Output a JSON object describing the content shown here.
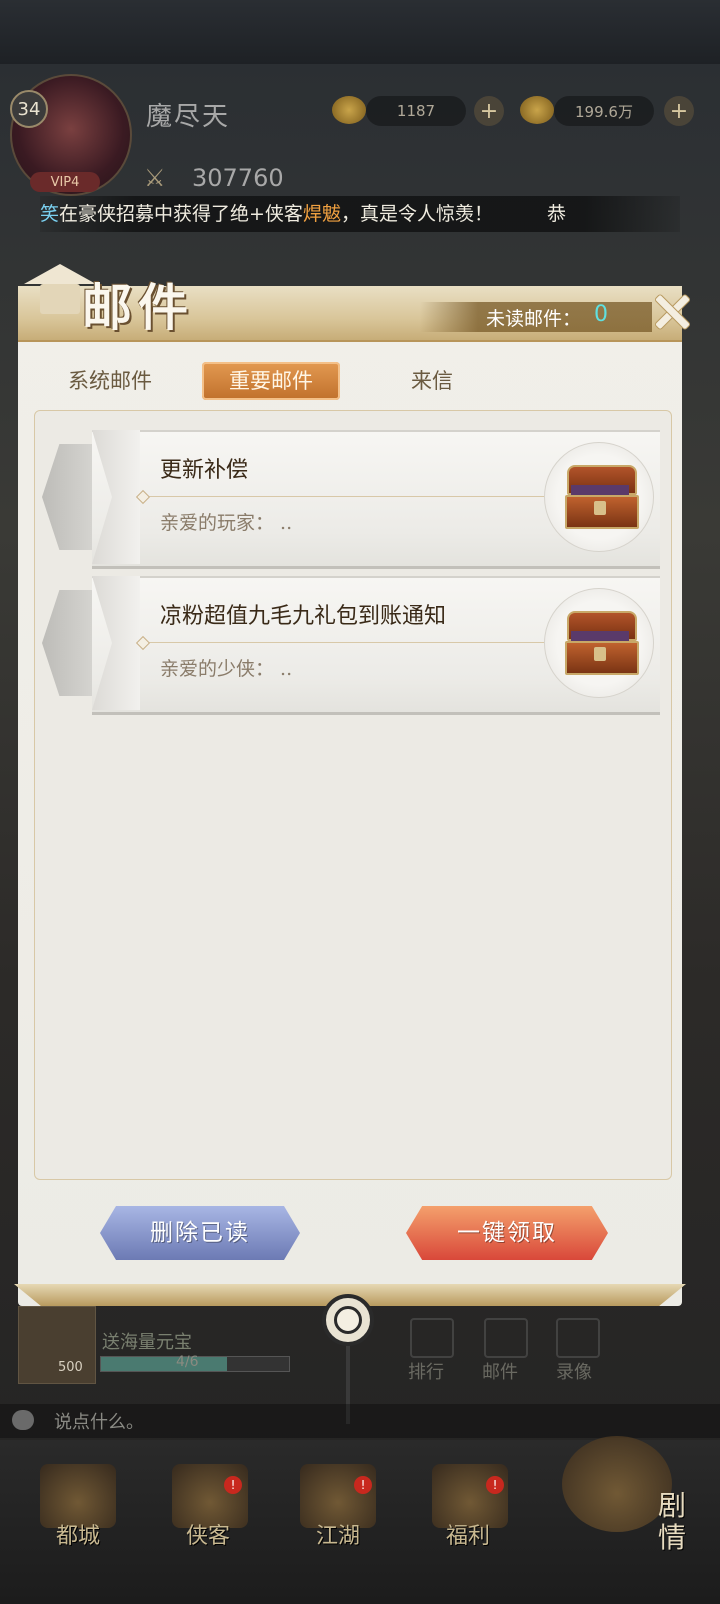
{
  "hud": {
    "level": "34",
    "vip": "VIP4",
    "player_name": "魔尽天",
    "gold": "1187",
    "coins": "199.6万",
    "power": "307760"
  },
  "marquee": {
    "part1": "笑",
    "part2": "在豪侠招募中获得了绝+侠客",
    "part3": "焊魃",
    "part4": "，真是令人惊羡！",
    "part5": "恭"
  },
  "mail_panel": {
    "title": "邮件",
    "unread_label": "未读邮件：",
    "unread_count": "0",
    "tabs": [
      {
        "label": "系统邮件",
        "active": false
      },
      {
        "label": "重要邮件",
        "active": true
      },
      {
        "label": "来信",
        "active": false
      }
    ],
    "mails": [
      {
        "title": "更新补偿",
        "preview": "亲爱的玩家：  ..",
        "icon": "treasure-chest-icon"
      },
      {
        "title": "凉粉超值九毛九礼包到账通知",
        "preview": "亲爱的少侠：  ..",
        "icon": "treasure-chest-icon"
      }
    ],
    "delete_read_label": "删除已读",
    "claim_all_label": "一键领取"
  },
  "event": {
    "count": "500",
    "text": "送海量元宝",
    "progress": "4/6",
    "progress_fraction": 0.67
  },
  "side_buttons": [
    "排行",
    "邮件",
    "录像"
  ],
  "chat_placeholder": "说点什么。",
  "nav": [
    {
      "label": "都城"
    },
    {
      "label": "侠客"
    },
    {
      "label": "江湖"
    },
    {
      "label": "福利"
    }
  ],
  "story_label": "剧情",
  "colors": {
    "accent_orange": "#c0702c",
    "unread_cyan": "#5fe0e0",
    "button_blue": "#6c7ab4",
    "button_red": "#d9483a"
  }
}
